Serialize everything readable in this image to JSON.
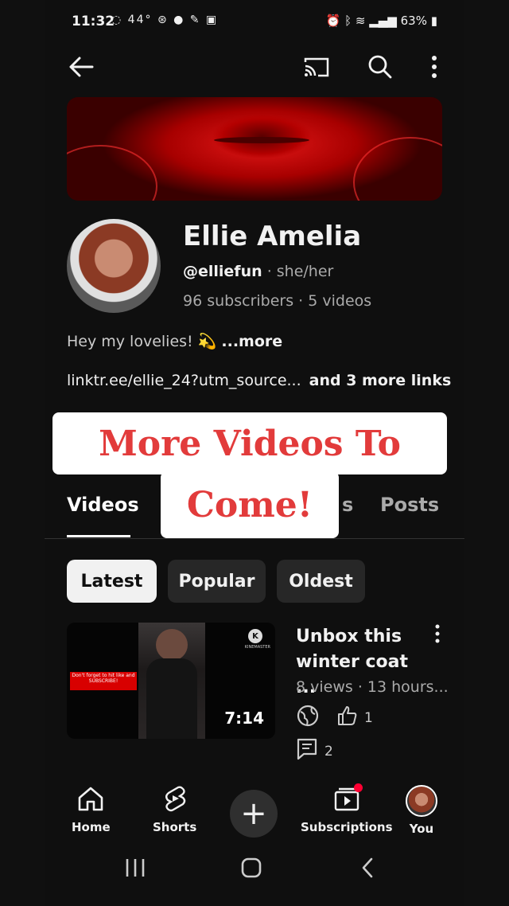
{
  "status": {
    "time": "11:32",
    "temp": "44°",
    "battery": "63%"
  },
  "channel": {
    "name": "Ellie Amelia",
    "handle": "@elliefun",
    "pronouns": "· she/her",
    "stats": "96 subscribers · 5 videos",
    "description": "Hey my lovelies! 💫 ",
    "more": "...more",
    "link": "linktr.ee/ellie_24?utm_source...",
    "more_links": "and 3 more links"
  },
  "overlay": {
    "line1": "More Videos To",
    "line2": "Come!"
  },
  "tabs": {
    "videos": "Videos",
    "hidden_partial": "s",
    "posts": "Posts"
  },
  "chips": {
    "latest": "Latest",
    "popular": "Popular",
    "oldest": "Oldest"
  },
  "video": {
    "title_line1": "Unbox this",
    "title_line2": "winter coat ...",
    "meta": "8 views · 13 hours...",
    "likes": "1",
    "comments": "2",
    "duration": "7:14",
    "thumb_text": "Don't forget to hit like and SUBSCRIBE!",
    "watermark": "KINEMASTER"
  },
  "bottomnav": {
    "home": "Home",
    "shorts": "Shorts",
    "subscriptions": "Subscriptions",
    "you": "You"
  },
  "colors": {
    "accent_red": "#e23b3b",
    "background": "#0f0f0f"
  }
}
